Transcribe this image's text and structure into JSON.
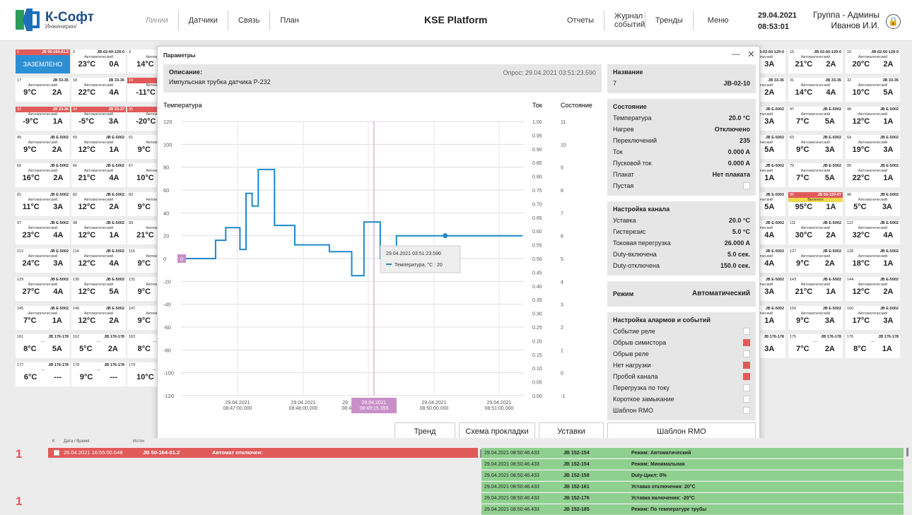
{
  "topbar": {
    "logo_name": "К-Софт",
    "logo_sub": "Инжиниринг",
    "nav_left": [
      "Линии",
      "Датчики",
      "Связь",
      "План"
    ],
    "brand": "KSE Platform",
    "nav_right": [
      "Отчеты",
      "Журнал событий",
      "Тренды",
      "Меню"
    ],
    "date": "29.04.2021",
    "time": "08:53:01",
    "group": "Группа - Админы",
    "user": "Иванов И.И."
  },
  "tiles_left": [
    [
      {
        "n": "1",
        "id": "JB 50-164-01.2",
        "s": "ЗАЗЕМЛЕНО",
        "t": "",
        "a": "",
        "cls": "blue"
      },
      {
        "n": "2",
        "id": "JB-02-60-129-0",
        "s": "Автоматический",
        "t": "23°C",
        "a": "0A"
      },
      {
        "n": "3",
        "id": "JB-02",
        "s": "Автомати",
        "t": "14°C",
        "a": ""
      }
    ],
    [
      {
        "n": "17",
        "id": "JB 33-35",
        "s": "Автоматический",
        "t": "9°C",
        "a": "2A"
      },
      {
        "n": "18",
        "id": "JB 33-35",
        "s": "Автоматический",
        "t": "22°C",
        "a": "4A"
      },
      {
        "n": "19",
        "id": "",
        "s": "Автомати",
        "t": "-11°C",
        "a": "",
        "cls": "red"
      }
    ],
    [
      {
        "n": "33",
        "id": "JB 33-36",
        "s": "Автоматический",
        "t": "-9°C",
        "a": "1A",
        "cls": "red"
      },
      {
        "n": "34",
        "id": "JB 33-37",
        "s": "Автоматический",
        "t": "-5°C",
        "a": "3A",
        "cls": "red"
      },
      {
        "n": "35",
        "id": "",
        "s": "Автомати",
        "t": "-20°C",
        "a": "",
        "cls": "red"
      }
    ],
    [
      {
        "n": "49",
        "id": "JB E-5002",
        "s": "Автоматический",
        "t": "9°C",
        "a": "2A"
      },
      {
        "n": "50",
        "id": "JB E-5002",
        "s": "Автоматический",
        "t": "12°C",
        "a": "1A"
      },
      {
        "n": "51",
        "id": "J",
        "s": "Автомати",
        "t": "9°C",
        "a": ""
      }
    ],
    [
      {
        "n": "65",
        "id": "JB E-5002",
        "s": "Автоматический",
        "t": "16°C",
        "a": "2A"
      },
      {
        "n": "66",
        "id": "JB E-5002",
        "s": "Автоматический",
        "t": "21°C",
        "a": "4A"
      },
      {
        "n": "67",
        "id": "J",
        "s": "Автомати",
        "t": "10°C",
        "a": ""
      }
    ],
    [
      {
        "n": "81",
        "id": "JB E-5002",
        "s": "Автоматический",
        "t": "11°C",
        "a": "3A"
      },
      {
        "n": "82",
        "id": "JB E-5002",
        "s": "Автоматический",
        "t": "12°C",
        "a": "2A"
      },
      {
        "n": "83",
        "id": "J",
        "s": "Автомати",
        "t": "9°C",
        "a": ""
      }
    ],
    [
      {
        "n": "97",
        "id": "JB E-5002",
        "s": "Автоматический",
        "t": "23°C",
        "a": "4A"
      },
      {
        "n": "98",
        "id": "JB E-5002",
        "s": "Автоматический",
        "t": "12°C",
        "a": "1A"
      },
      {
        "n": "99",
        "id": "J",
        "s": "Автомати",
        "t": "21°C",
        "a": ""
      }
    ],
    [
      {
        "n": "113",
        "id": "JB E-5002",
        "s": "Автоматический",
        "t": "24°C",
        "a": "3A"
      },
      {
        "n": "114",
        "id": "JB E-5002",
        "s": "Автоматический",
        "t": "12°C",
        "a": "4A"
      },
      {
        "n": "115",
        "id": "J",
        "s": "Автомати",
        "t": "9°C",
        "a": ""
      }
    ],
    [
      {
        "n": "129",
        "id": "JB E-5002",
        "s": "Автоматический",
        "t": "27°C",
        "a": "4A"
      },
      {
        "n": "130",
        "id": "JB E-5002",
        "s": "Автоматический",
        "t": "12°C",
        "a": "5A"
      },
      {
        "n": "131",
        "id": "J",
        "s": "Автомати",
        "t": "9°C",
        "a": ""
      }
    ],
    [
      {
        "n": "145",
        "id": "JB E-5002",
        "s": "Автоматический",
        "t": "7°C",
        "a": "1A"
      },
      {
        "n": "146",
        "id": "JB E-5002",
        "s": "Автоматический",
        "t": "12°C",
        "a": "2A"
      },
      {
        "n": "147",
        "id": "J",
        "s": "Автомати",
        "t": "9°C",
        "a": ""
      }
    ],
    [
      {
        "n": "161",
        "id": "JB 176-178",
        "s": "---",
        "t": "8°C",
        "a": "5A"
      },
      {
        "n": "162",
        "id": "JB 176-178",
        "s": "---",
        "t": "5°C",
        "a": "2A"
      },
      {
        "n": "163",
        "id": "JB",
        "s": "---",
        "t": "8°C",
        "a": ""
      }
    ],
    [
      {
        "n": "177",
        "id": "JB 176-178",
        "s": "---",
        "t": "6°C",
        "a": "---"
      },
      {
        "n": "178",
        "id": "JB 176-178",
        "s": "---",
        "t": "9°C",
        "a": "---"
      },
      {
        "n": "179",
        "id": "JB",
        "s": "---",
        "t": "10°C",
        "a": ""
      }
    ]
  ],
  "tiles_right": [
    [
      {
        "n": "",
        "id": "JB-02-60-129-0",
        "s": "Автоматический",
        "t": "",
        "a": "3A"
      },
      {
        "n": "15",
        "id": "JB-02-60-129-0",
        "s": "Автоматический",
        "t": "21°C",
        "a": "2A"
      },
      {
        "n": "16",
        "id": "JB-02-60-129-0",
        "s": "Автоматический",
        "t": "20°C",
        "a": "2A"
      }
    ],
    [
      {
        "n": "",
        "id": "JB 33-35",
        "s": "Автоматический",
        "t": "",
        "a": "2A"
      },
      {
        "n": "31",
        "id": "JB 33-35",
        "s": "Автоматический",
        "t": "14°C",
        "a": "4A"
      },
      {
        "n": "32",
        "id": "JB 33-35",
        "s": "Автоматический",
        "t": "10°C",
        "a": "5A"
      }
    ],
    [
      {
        "n": "",
        "id": "JB E-5002",
        "s": "Автоматический",
        "t": "",
        "a": "3A"
      },
      {
        "n": "47",
        "id": "JB E-5002",
        "s": "Автоматический",
        "t": "7°C",
        "a": "5A"
      },
      {
        "n": "48",
        "id": "JB E-5002",
        "s": "Автоматический",
        "t": "12°C",
        "a": "1A"
      }
    ],
    [
      {
        "n": "",
        "id": "JB E-5002",
        "s": "Автоматический",
        "t": "",
        "a": "5A"
      },
      {
        "n": "63",
        "id": "JB E-5002",
        "s": "Автоматический",
        "t": "9°C",
        "a": "3A"
      },
      {
        "n": "64",
        "id": "JB E-5002",
        "s": "Автоматический",
        "t": "19°C",
        "a": "3A"
      }
    ],
    [
      {
        "n": "",
        "id": "JB E-5002",
        "s": "Автоматический",
        "t": "",
        "a": "1A"
      },
      {
        "n": "79",
        "id": "JB E-5002",
        "s": "Автоматический",
        "t": "7°C",
        "a": "5A"
      },
      {
        "n": "80",
        "id": "JB E-5002",
        "s": "Автоматический",
        "t": "22°C",
        "a": "1A"
      }
    ],
    [
      {
        "n": "",
        "id": "JB E-5002",
        "s": "Автоматический",
        "t": "",
        "a": "5A"
      },
      {
        "n": "95",
        "id": "JB 50-120-07",
        "s": "Включен",
        "t": "95°C",
        "a": "1A",
        "cls": "yel"
      },
      {
        "n": "96",
        "id": "JB E-5002",
        "s": "Автоматический",
        "t": "5°C",
        "a": "3A"
      }
    ],
    [
      {
        "n": "",
        "id": "JB E-5002",
        "s": "Автоматический",
        "t": "",
        "a": "4A"
      },
      {
        "n": "111",
        "id": "JB E-5002",
        "s": "Автоматический",
        "t": "30°C",
        "a": "2A"
      },
      {
        "n": "112",
        "id": "JB E-5002",
        "s": "Автоматический",
        "t": "32°C",
        "a": "4A"
      }
    ],
    [
      {
        "n": "",
        "id": "JB E-5002",
        "s": "Автоматический",
        "t": "",
        "a": "4A"
      },
      {
        "n": "127",
        "id": "JB E-5002",
        "s": "Автоматический",
        "t": "9°C",
        "a": "2A"
      },
      {
        "n": "128",
        "id": "JB E-5002",
        "s": "Автоматический",
        "t": "18°C",
        "a": "1A"
      }
    ],
    [
      {
        "n": "",
        "id": "JB E-5002",
        "s": "Автоматический",
        "t": "",
        "a": "3A"
      },
      {
        "n": "143",
        "id": "JB E-5002",
        "s": "Автоматический",
        "t": "21°C",
        "a": "1A"
      },
      {
        "n": "144",
        "id": "JB E-5002",
        "s": "Автоматический",
        "t": "12°C",
        "a": "2A"
      }
    ],
    [
      {
        "n": "",
        "id": "JB E-5002",
        "s": "Автоматический",
        "t": "",
        "a": "1A"
      },
      {
        "n": "159",
        "id": "JB E-5002",
        "s": "Автоматический",
        "t": "9°C",
        "a": "3A"
      },
      {
        "n": "160",
        "id": "JB E-5002",
        "s": "Автоматический",
        "t": "17°C",
        "a": "3A"
      }
    ],
    [
      {
        "n": "",
        "id": "JB 176-178",
        "s": "---",
        "t": "",
        "a": "3A"
      },
      {
        "n": "175",
        "id": "JB 176-178",
        "s": "---",
        "t": "7°C",
        "a": "2A"
      },
      {
        "n": "176",
        "id": "JB 176-178",
        "s": "---",
        "t": "8°C",
        "a": "1A"
      }
    ]
  ],
  "dialog": {
    "title": "Параметры",
    "desc_label": "Описание:",
    "desc_value": "Импульсная трубка датчика Р-232",
    "poll": "Опрос: 29.04.2021 03:51:23.590",
    "name_title": "Название",
    "name_num": "7",
    "name_value": "JB-02-10",
    "state_title": "Состояние",
    "state_rows": [
      [
        "Температура",
        "20.0 °C"
      ],
      [
        "Нагрев",
        "Отключено"
      ],
      [
        "Переключений",
        "235"
      ],
      [
        "Ток",
        "0.000 A"
      ],
      [
        "Пусковой ток",
        "0.000 A"
      ],
      [
        "Плакат",
        "Нет плаката"
      ]
    ],
    "empty_label": "Пустая",
    "channel_title": "Настройка канала",
    "channel_rows": [
      [
        "Уставка",
        "20.0 °C"
      ],
      [
        "Гистерезис",
        "5.0 °C"
      ],
      [
        "Токовая перегрузка",
        "26.000 A"
      ],
      [
        "Duty-включена",
        "5.0 сек."
      ],
      [
        "Duty-отключена",
        "150.0 сек."
      ]
    ],
    "mode_label": "Режим",
    "mode_value": "Автоматический",
    "alarm_title": "Настройка алармов и событий",
    "alarm_rows": [
      [
        "Событие реле",
        false
      ],
      [
        "Обрыв симистора",
        true
      ],
      [
        "Обрыв реле",
        false
      ],
      [
        "Нет нагрузки",
        true
      ],
      [
        "Пробой канала",
        true
      ],
      [
        "Перегрузка по току",
        false
      ],
      [
        "Короткое замыкание",
        false
      ],
      [
        "Шаблон RMO",
        false
      ]
    ],
    "buttons": [
      "Тренд",
      "Схема прокладки",
      "Уставки",
      "Шаблон RMO"
    ]
  },
  "chart_data": {
    "type": "line",
    "title": "",
    "left_label": "Температура",
    "mid_label": "Ток",
    "right_label": "Состояние",
    "ylim": [
      -120,
      120
    ],
    "yticks": [
      120,
      100,
      80,
      60,
      40,
      20,
      0,
      -20,
      -40,
      -60,
      -80,
      -100,
      -120
    ],
    "current_ticks": [
      "1.00",
      "0.95",
      "0.90",
      "0.85",
      "0.80",
      "0.75",
      "0.70",
      "0.65",
      "0.60",
      "0.55",
      "0.50",
      "0.45",
      "0.40",
      "0.35",
      "0.30",
      "0.25",
      "0.20",
      "0.15",
      "0.10",
      "0.05",
      "0.00"
    ],
    "state_ticks": [
      "11",
      "10",
      "9",
      "8",
      "7",
      "6",
      "5",
      "4",
      "3",
      "2",
      "1",
      "0",
      "-1"
    ],
    "xticks": [
      [
        "29.04.2021",
        "08:47:00.000"
      ],
      [
        "29.04.2021",
        "08:48:00.000"
      ],
      [
        "29.04.2021",
        "08:50:00.000"
      ],
      [
        "29.04.2021",
        "08:51:00.000"
      ]
    ],
    "cursor_label": [
      "29.04.2021",
      "08:49:15.359"
    ],
    "cursor_partial": "29.",
    "cursor_partial2": "08:4",
    "zero_badge": "0",
    "series_color": "#1e88c8",
    "series": [
      {
        "name": "Температура, °C",
        "x": [
          0,
          0.85,
          0.85,
          1.1,
          1.1,
          1.45,
          1.45,
          1.6,
          1.6,
          1.75,
          1.75,
          1.9,
          1.9,
          2.3,
          2.3,
          2.8,
          2.8,
          3.65,
          3.65,
          4.2,
          4.2,
          4.5,
          4.5,
          4.9,
          4.9,
          5.3,
          5.3,
          6.5,
          6.5,
          8.4
        ],
        "values": [
          0,
          0,
          16,
          16,
          27,
          27,
          8,
          8,
          57,
          57,
          46,
          46,
          78,
          78,
          29,
          29,
          12,
          12,
          6,
          6,
          -15,
          -15,
          32,
          32,
          0,
          0,
          20,
          20,
          20,
          20
        ]
      }
    ],
    "tooltip": {
      "time": "29.04.2021 03:51:23.590",
      "entry": "Температура, °C : 20"
    }
  },
  "bottom": {
    "count1": "1",
    "count2": "1",
    "headers": [
      "К",
      "Дата / Время",
      "Источ"
    ],
    "alarm": {
      "time": "26.04.2021 16:55:00.648",
      "src": "JB 50-164-01.2",
      "msg": "Автомат отключен:"
    },
    "events": [
      [
        "29.04.2021 08:50:46.433",
        "JB 152-154",
        "Режим: Автоматический"
      ],
      [
        "29.04.2021 08:50:46.433",
        "JB 152-154",
        "Режим: Минимальная"
      ],
      [
        "29.04.2021 08:50:46.433",
        "JB 152-158",
        "Duty-Цикл: 0%"
      ],
      [
        "29.04.2021 08:50:46.433",
        "JB 152-161",
        "Уставка отключения: 20°C"
      ],
      [
        "29.04.2021 08:50:46.433",
        "JB 152-176",
        "Уставка включения: -20°C"
      ],
      [
        "29.04.2021 08:50:46.433",
        "JB 152-185",
        "Режим: По температуре трубы"
      ]
    ]
  },
  "colors": {
    "red": "#e05a5a",
    "blue": "#2b8fd6",
    "green": "#8fcf8f",
    "cursor": "#c98fc9"
  }
}
